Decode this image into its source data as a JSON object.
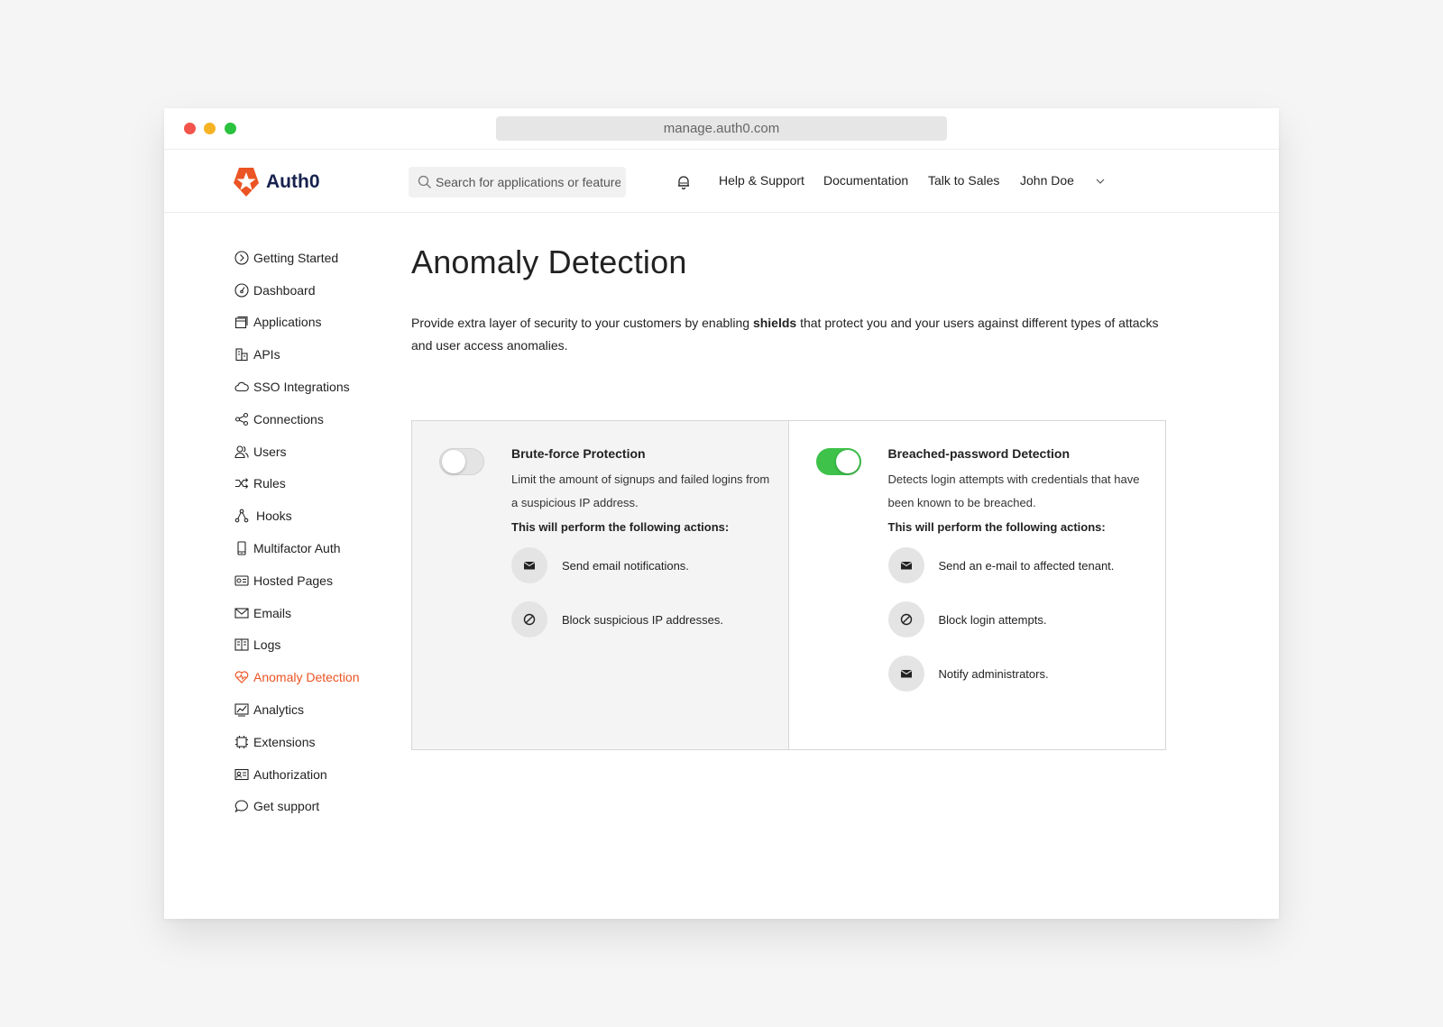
{
  "browser": {
    "url": "manage.auth0.com"
  },
  "header": {
    "logo_text": "Auth0",
    "search_placeholder": "Search for applications or features",
    "nav": {
      "help": "Help & Support",
      "docs": "Documentation",
      "sales": "Talk to Sales",
      "user": "John Doe"
    }
  },
  "sidebar": {
    "items": [
      {
        "label": "Getting Started",
        "icon": "chevron-circle-icon"
      },
      {
        "label": "Dashboard",
        "icon": "gauge-icon"
      },
      {
        "label": "Applications",
        "icon": "window-stack-icon"
      },
      {
        "label": "APIs",
        "icon": "building-icon"
      },
      {
        "label": "SSO Integrations",
        "icon": "cloud-icon"
      },
      {
        "label": "Connections",
        "icon": "share-nodes-icon"
      },
      {
        "label": "Users",
        "icon": "users-icon"
      },
      {
        "label": "Rules",
        "icon": "shuffle-icon"
      },
      {
        "label": "Hooks",
        "icon": "hooks-icon"
      },
      {
        "label": "Multifactor Auth",
        "icon": "phone-icon"
      },
      {
        "label": "Hosted Pages",
        "icon": "id-card-icon"
      },
      {
        "label": "Emails",
        "icon": "envelope-icon"
      },
      {
        "label": "Logs",
        "icon": "book-icon"
      },
      {
        "label": "Anomaly Detection",
        "icon": "heart-pulse-icon",
        "active": true
      },
      {
        "label": "Analytics",
        "icon": "chart-icon"
      },
      {
        "label": "Extensions",
        "icon": "chip-icon"
      },
      {
        "label": "Authorization",
        "icon": "badge-icon"
      },
      {
        "label": "Get support",
        "icon": "chat-bubble-icon"
      }
    ],
    "active_color": "#eb5424"
  },
  "main": {
    "title": "Anomaly Detection",
    "desc_before": "Provide extra layer of security to your customers by enabling ",
    "desc_bold": "shields",
    "desc_after": " that protect you and your users against different types of attacks and user access anomalies.",
    "cards": [
      {
        "title": "Brute-force Protection",
        "description": "Limit the amount of signups and failed logins from a suspicious IP address.",
        "enabled": false,
        "actions_heading": "This will perform the following actions:",
        "actions": [
          {
            "icon": "envelope-icon",
            "label": "Send email notifications."
          },
          {
            "icon": "block-icon",
            "label": "Block suspicious IP addresses."
          }
        ]
      },
      {
        "title": "Breached-password Detection",
        "description": "Detects login attempts with credentials that have been known to be breached.",
        "enabled": true,
        "actions_heading": "This will perform the following actions:",
        "actions": [
          {
            "icon": "envelope-icon",
            "label": "Send an e-mail to affected tenant."
          },
          {
            "icon": "block-icon",
            "label": "Block login attempts."
          },
          {
            "icon": "envelope-icon",
            "label": "Notify administrators."
          }
        ]
      }
    ]
  },
  "colors": {
    "toggle_on": "#3ec24a",
    "brand": "#eb5424",
    "logo_text": "#16214d"
  }
}
